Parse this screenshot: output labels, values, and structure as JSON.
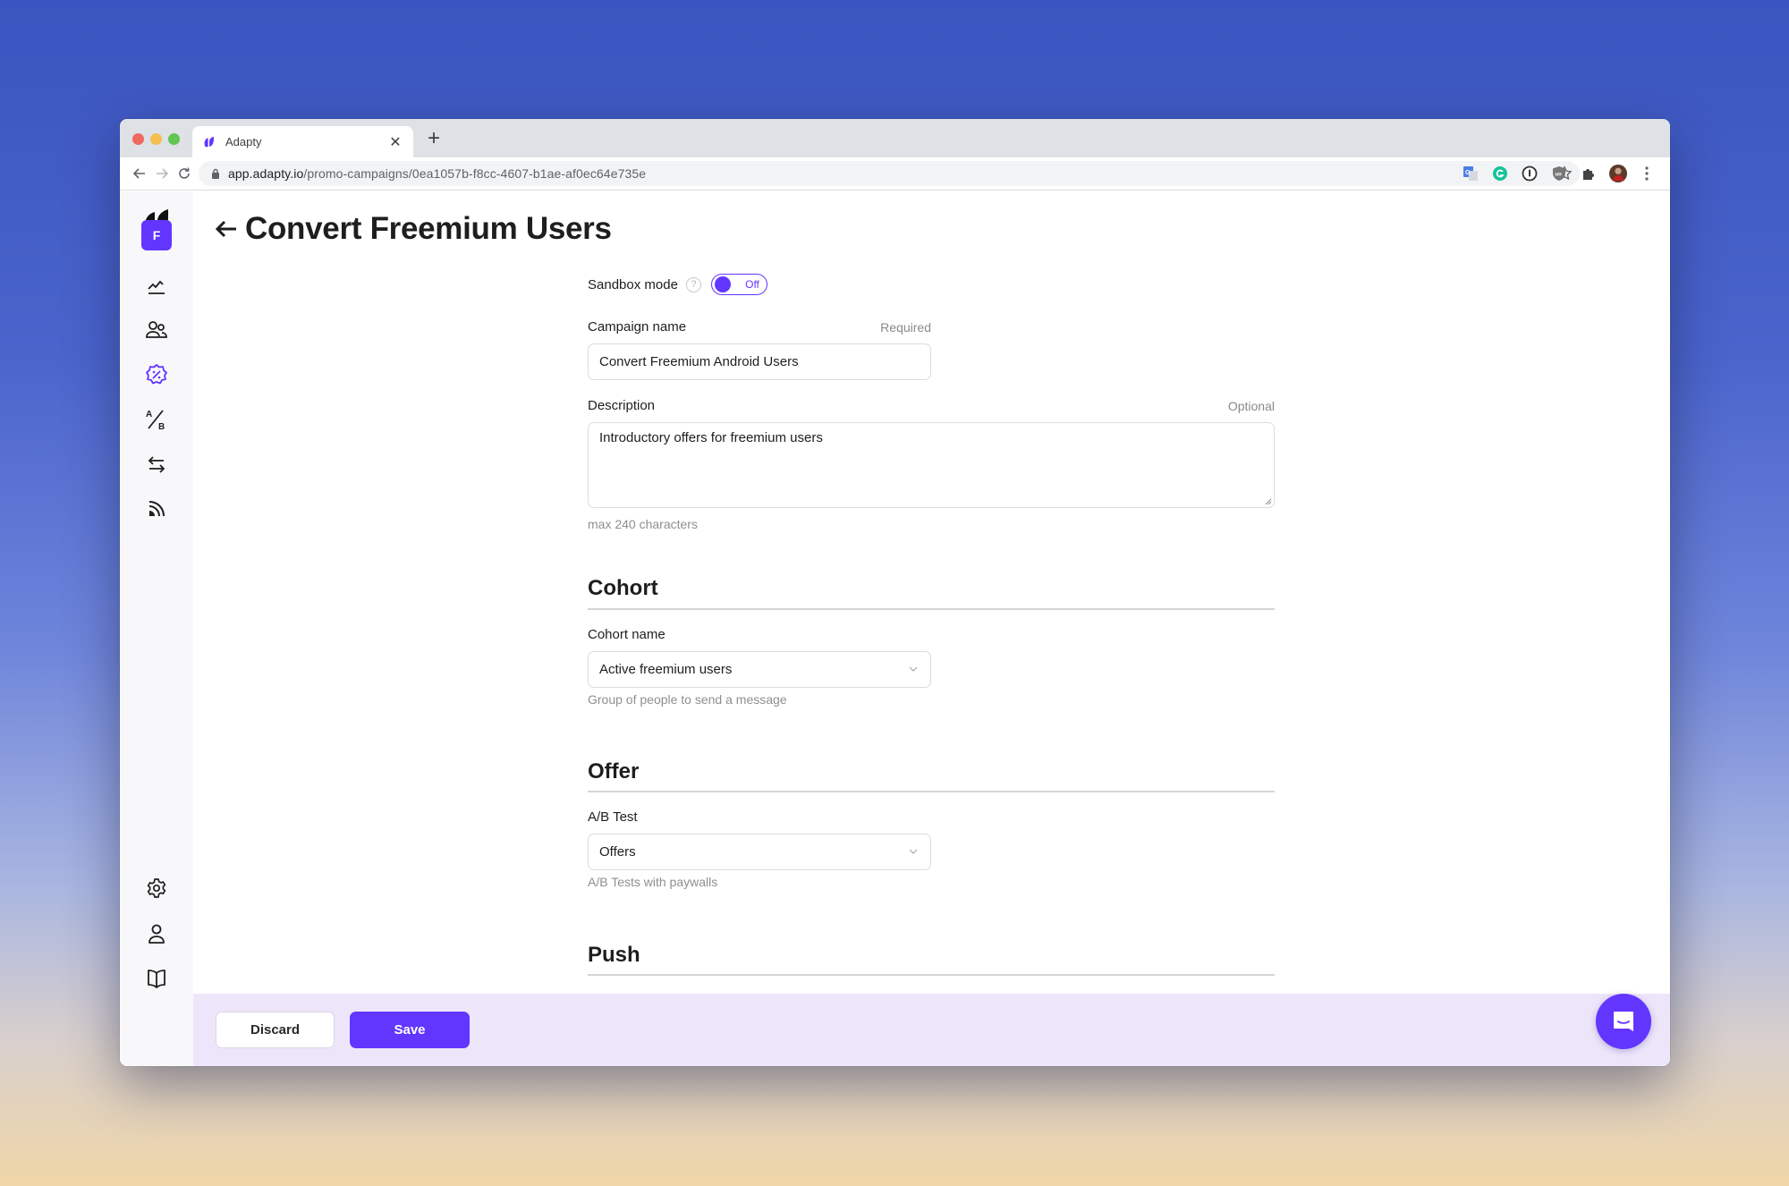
{
  "browser": {
    "tab": {
      "title": "Adapty",
      "favicon": "adapty-logo-icon"
    },
    "new_tab_label": "+",
    "close_tab_label": "✕",
    "url_host": "app.adapty.io",
    "url_path": "/promo-campaigns/0ea1057b-f8cc-4607-b1ae-af0ec64e735e",
    "extensions": [
      "google-translate-icon",
      "grammarly-icon",
      "1password-icon",
      "ublock-icon",
      "extensions-puzzle-icon",
      "profile-avatar",
      "kebab-menu-icon"
    ]
  },
  "sidebar": {
    "workspace_initial": "F",
    "items": [
      {
        "name": "analytics",
        "icon": "chart-line-icon",
        "active": false
      },
      {
        "name": "users",
        "icon": "users-icon",
        "active": false
      },
      {
        "name": "promo-campaigns",
        "icon": "discount-badge-icon",
        "active": true
      },
      {
        "name": "ab-tests",
        "icon": "ab-test-icon",
        "active": false
      },
      {
        "name": "integrations",
        "icon": "arrows-exchange-icon",
        "active": false
      },
      {
        "name": "events-feed",
        "icon": "rss-feed-icon",
        "active": false
      }
    ],
    "bottom_items": [
      {
        "name": "settings",
        "icon": "gear-icon"
      },
      {
        "name": "account",
        "icon": "user-icon"
      },
      {
        "name": "docs",
        "icon": "book-icon"
      }
    ]
  },
  "page": {
    "title": "Convert Freemium Users",
    "back_label": "←"
  },
  "form": {
    "sandbox": {
      "label": "Sandbox mode",
      "help": "?",
      "toggle_state": "Off"
    },
    "campaign_name": {
      "label": "Campaign name",
      "hint": "Required",
      "value": "Convert Freemium Android Users"
    },
    "description": {
      "label": "Description",
      "hint": "Optional",
      "value": "Introductory offers for freemium users",
      "helper": "max 240 characters"
    },
    "cohort": {
      "heading": "Cohort",
      "field_label": "Cohort name",
      "value": "Active freemium users",
      "helper": "Group of people to send a message"
    },
    "offer": {
      "heading": "Offer",
      "field_label": "A/B Test",
      "value": "Offers",
      "helper": "A/B Tests with paywalls"
    },
    "push": {
      "heading": "Push"
    }
  },
  "footer": {
    "discard_label": "Discard",
    "save_label": "Save"
  },
  "colors": {
    "accent": "#6236ff",
    "footer_bg": "#ede6fa",
    "sidebar_bg": "#f8f8fb"
  }
}
